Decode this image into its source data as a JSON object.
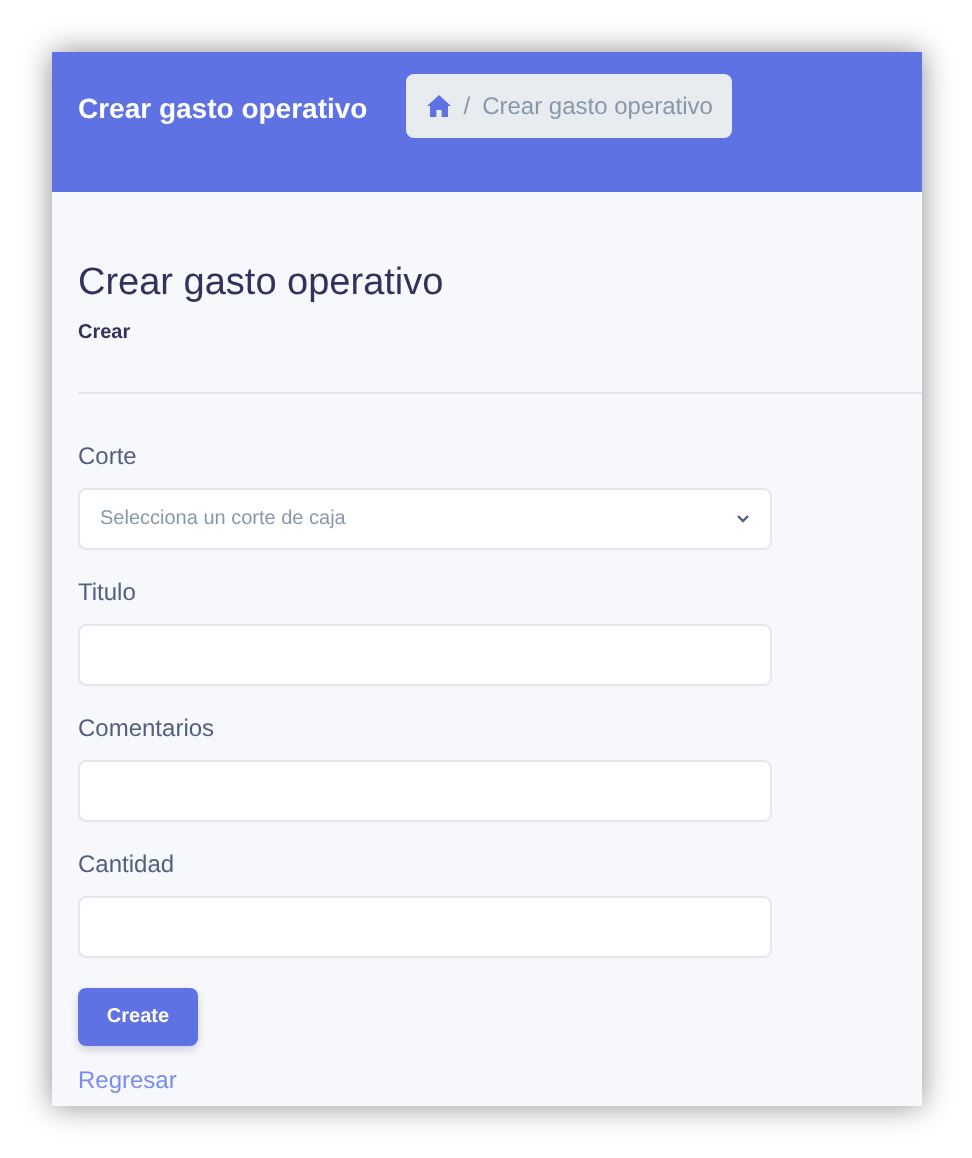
{
  "header": {
    "title": "Crear gasto operativo",
    "breadcrumb": {
      "separator": "/",
      "current": "Crear gasto operativo"
    }
  },
  "page": {
    "title": "Crear gasto operativo",
    "subtitle": "Crear"
  },
  "fields": [
    {
      "kind": "select",
      "label": "Corte",
      "placeholder": "Selecciona un corte de caja"
    },
    {
      "kind": "input",
      "label": "Titulo"
    },
    {
      "kind": "input",
      "label": "Comentarios"
    },
    {
      "kind": "input",
      "label": "Cantidad"
    }
  ],
  "submit_button": "Create",
  "back_link": "Regresar"
}
